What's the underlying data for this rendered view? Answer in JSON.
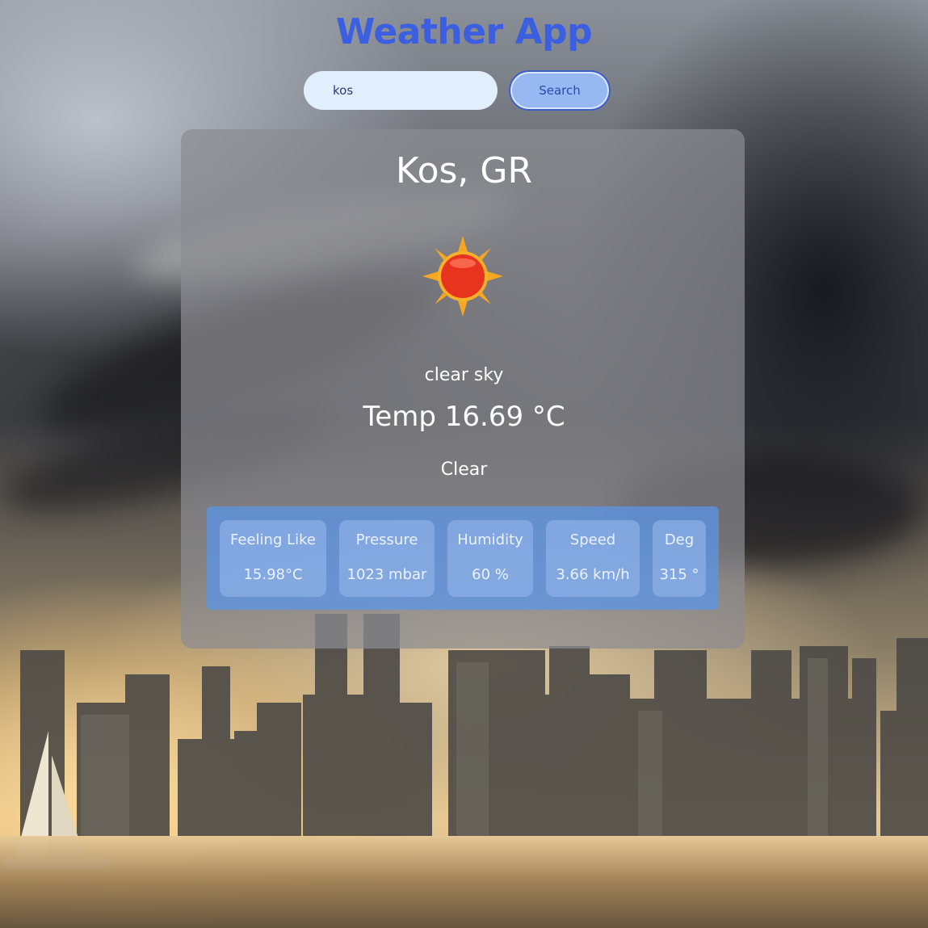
{
  "header": {
    "title": "Weather App"
  },
  "search": {
    "value": "kos",
    "button_label": "Search"
  },
  "weather": {
    "city": "Kos, GR",
    "icon": "sun-icon",
    "description": "clear sky",
    "temp": "Temp 16.69 °C",
    "main": "Clear"
  },
  "details": [
    {
      "label": "Feeling Like",
      "value": "15.98°C"
    },
    {
      "label": "Pressure",
      "value": "1023 mbar"
    },
    {
      "label": "Humidity",
      "value": "60 %"
    },
    {
      "label": "Speed",
      "value": "3.66 km/h"
    },
    {
      "label": "Deg",
      "value": "315 °"
    }
  ],
  "colors": {
    "title": "#3b5fe0",
    "input_bg": "#e1effc",
    "button_bg": "#97b8f0",
    "card_bg": "rgba(140,140,145,0.72)",
    "details_bg": "rgba(90,150,235,0.72)"
  }
}
